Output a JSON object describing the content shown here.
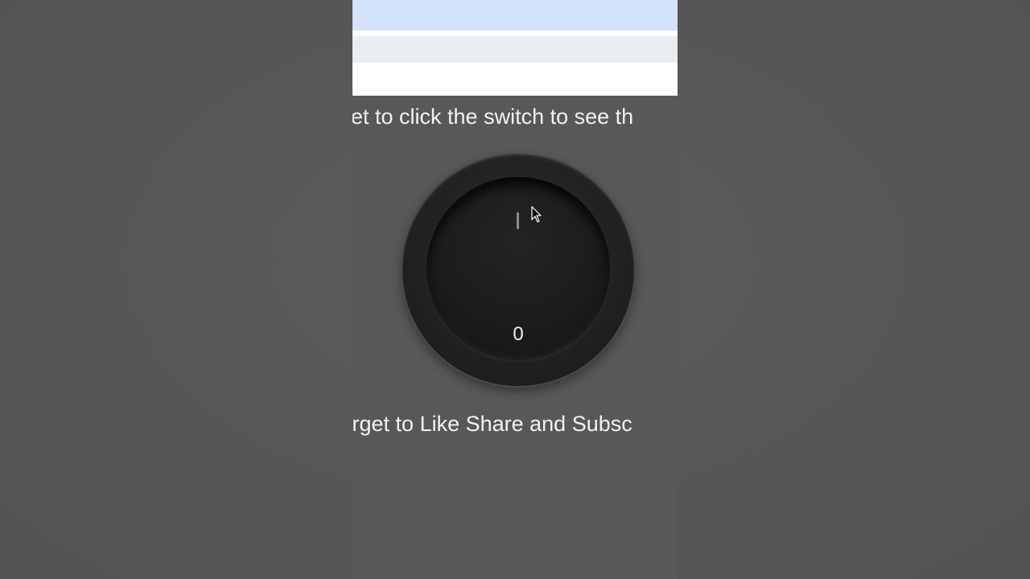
{
  "captions": {
    "top": "rget to click the switch to see th",
    "bottom": "t forget to Like Share and Subsc"
  },
  "switch": {
    "on_mark": "|",
    "off_mark": "0",
    "state": "off"
  },
  "colors": {
    "background": "#585858",
    "browser_tab_strip": "#d3e3fd",
    "browser_toolbar": "#e8edef",
    "switch_body": "#1f1f1f",
    "caption_text": "#f2f2f2"
  },
  "icons": {
    "cursor": "mouse-pointer-icon"
  }
}
